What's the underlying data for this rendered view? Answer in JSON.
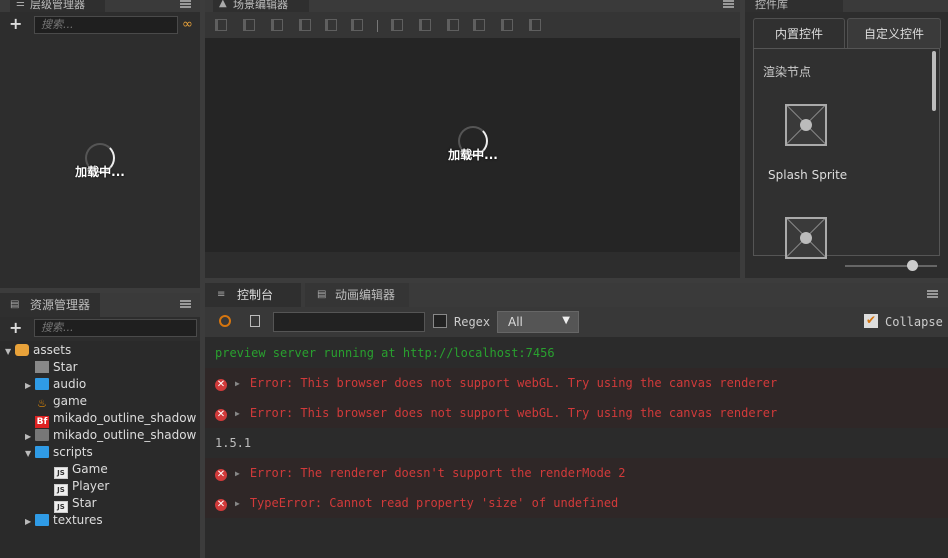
{
  "hierarchy": {
    "title": "层级管理器",
    "search_placeholder": "搜索...",
    "loading": "加载中..."
  },
  "scene": {
    "title": "场景编辑器",
    "loading": "加载中..."
  },
  "library": {
    "title": "控件库",
    "tabs": [
      "内置控件",
      "自定义控件"
    ],
    "section": "渲染节点",
    "items": [
      "Splash Sprite"
    ]
  },
  "assets": {
    "title": "资源管理器",
    "search_placeholder": "搜索...",
    "tree": [
      {
        "label": "assets",
        "icon": "assets-icon",
        "depth": 0,
        "arrow": "▼"
      },
      {
        "label": "Star",
        "icon": "prefab-icon",
        "depth": 1,
        "arrow": ""
      },
      {
        "label": "audio",
        "icon": "folder-icon",
        "depth": 1,
        "arrow": "▶"
      },
      {
        "label": "game",
        "icon": "scene-icon",
        "depth": 1,
        "arrow": ""
      },
      {
        "label": "mikado_outline_shadow",
        "icon": "bitmap-font-icon",
        "depth": 1,
        "arrow": ""
      },
      {
        "label": "mikado_outline_shadow",
        "icon": "texture-icon",
        "depth": 1,
        "arrow": "▶"
      },
      {
        "label": "scripts",
        "icon": "folder-icon",
        "depth": 1,
        "arrow": "▼"
      },
      {
        "label": "Game",
        "icon": "js-icon",
        "depth": 2,
        "arrow": ""
      },
      {
        "label": "Player",
        "icon": "js-icon",
        "depth": 2,
        "arrow": ""
      },
      {
        "label": "Star",
        "icon": "js-icon",
        "depth": 2,
        "arrow": ""
      },
      {
        "label": "textures",
        "icon": "folder-icon",
        "depth": 1,
        "arrow": "▶"
      }
    ]
  },
  "console": {
    "tabs": [
      "控制台",
      "动画编辑器"
    ],
    "regex_label": "Regex",
    "filter_value": "All",
    "collapse_label": "Collapse",
    "logs": [
      {
        "type": "info",
        "text": "preview server running at http://localhost:7456"
      },
      {
        "type": "error",
        "text": "Error: This browser does not support webGL. Try using the canvas renderer"
      },
      {
        "type": "error",
        "text": "Error: This browser does not support webGL. Try using the canvas renderer"
      },
      {
        "type": "plain",
        "text": "1.5.1"
      },
      {
        "type": "error",
        "text": "Error: The renderer doesn't support the renderMode 2"
      },
      {
        "type": "error",
        "text": "TypeError: Cannot read property 'size' of undefined"
      }
    ]
  },
  "colors": {
    "accent_orange": "#e8a23a",
    "error_red": "#d13a3a",
    "info_green": "#29a02f",
    "folder_blue": "#2f9be6"
  }
}
